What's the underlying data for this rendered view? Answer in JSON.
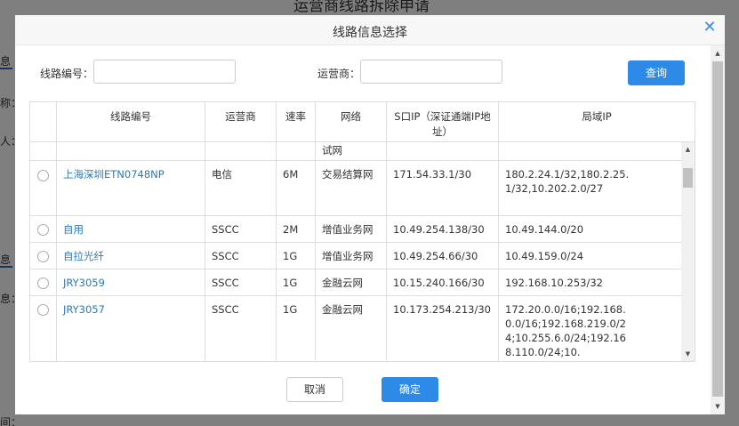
{
  "background": {
    "page_title": "运营商线路拆除申请",
    "left_fragments": [
      "息",
      "称：",
      "人：",
      "息",
      "息：",
      "间："
    ]
  },
  "dialog": {
    "title": "线路信息选择",
    "close_icon": "close-icon",
    "filters": {
      "line_no_label": "线路编号：",
      "line_no_value": "",
      "carrier_label": "运营商：",
      "carrier_value": "",
      "query_button": "查询"
    },
    "table": {
      "headers": [
        "",
        "线路编号",
        "运营商",
        "速率",
        "网络",
        "S口IP（深证通端IP地址）",
        "局域IP"
      ],
      "partial_row": {
        "network": "试网"
      },
      "rows": [
        {
          "line_no": "上海深圳ETN0748NP",
          "carrier": "电信",
          "rate": "6M",
          "network": "交易结算网",
          "sip": "171.54.33.1/30",
          "lan_ip": "180.2.24.1/32,180.2.25.1/32,10.202.2.0/27"
        },
        {
          "line_no": "自用",
          "carrier": "SSCC",
          "rate": "2M",
          "network": "增值业务网",
          "sip": "10.49.254.138/30",
          "lan_ip": "10.49.144.0/20"
        },
        {
          "line_no": "自拉光纤",
          "carrier": "SSCC",
          "rate": "1G",
          "network": "增值业务网",
          "sip": "10.49.254.66/30",
          "lan_ip": "10.49.159.0/24"
        },
        {
          "line_no": "JRY3059",
          "carrier": "SSCC",
          "rate": "1G",
          "network": "金融云网",
          "sip": "10.15.240.166/30",
          "lan_ip": "192.168.10.253/32"
        },
        {
          "line_no": "JRY3057",
          "carrier": "SSCC",
          "rate": "1G",
          "network": "金融云网",
          "sip": "10.173.254.213/30",
          "lan_ip": "172.20.0.0/16;192.168.0.0/16;192.168.219.0/24;10.255.6.0/24;192.168.110.0/24;10."
        }
      ]
    },
    "cancel_button": "取消",
    "ok_button": "确定"
  },
  "colors": {
    "primary": "#2d8ae6",
    "link": "#2a7ab8",
    "overlay": "rgba(0,0,0,0.5)"
  }
}
